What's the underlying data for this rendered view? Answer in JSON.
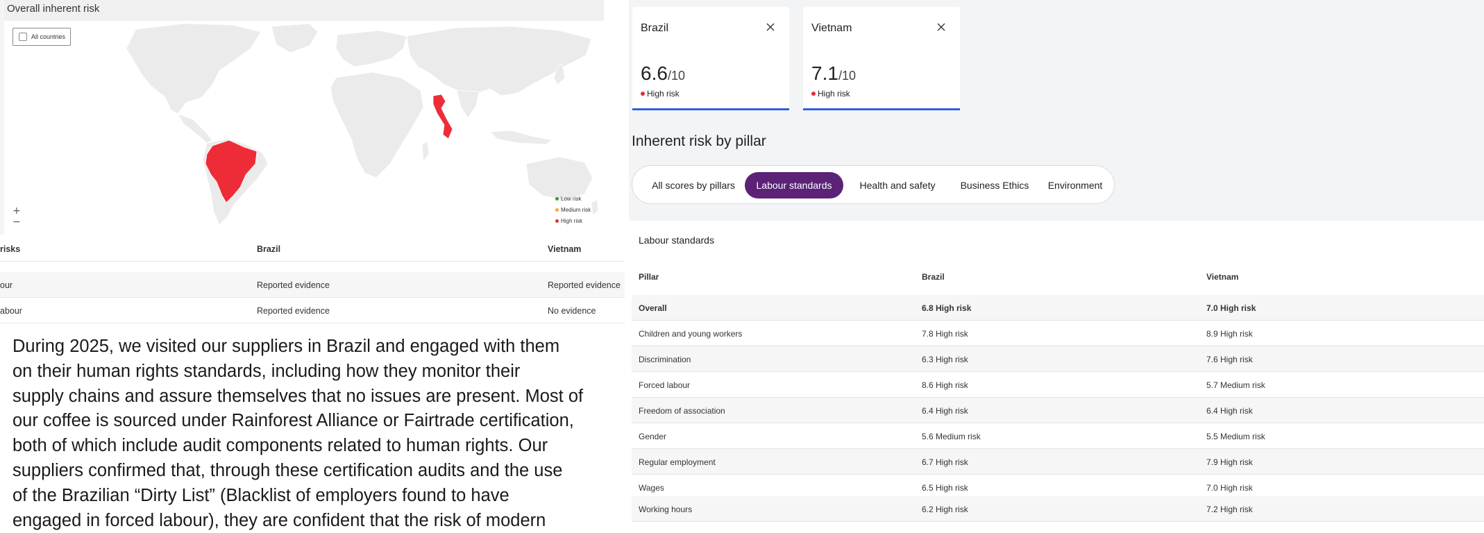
{
  "map": {
    "title": "Overall inherent risk",
    "filter_label": "All countries",
    "zoom_in": "+",
    "zoom_out": "−",
    "legend": [
      {
        "label": "Low risk",
        "color": "#2e9a3e"
      },
      {
        "label": "Medium risk",
        "color": "#f2a73b"
      },
      {
        "label": "High risk",
        "color": "#e0303a"
      }
    ],
    "highlight_color": "#ee2c37",
    "land_color": "#ebebeb"
  },
  "left_table": {
    "headers": [
      "risks",
      "Brazil",
      "Vietnam"
    ],
    "rows": [
      [
        "our",
        "Reported evidence",
        "Reported evidence"
      ],
      [
        "abour",
        "Reported evidence",
        "No evidence"
      ]
    ]
  },
  "paragraph": {
    "lines": [
      "During 2025, we visited our suppliers in Brazil and engaged with them",
      "on their human rights standards, including how they monitor their",
      "supply chains and assure themselves that no issues are present. Most of",
      "our coffee is sourced under Rainforest Alliance or Fairtrade certification,",
      "both of which include audit components related to human rights. Our",
      "suppliers confirmed that, through these certification audits and the use",
      "of the Brazilian “Dirty List” (Blacklist of employers found to have",
      "engaged in forced labour), they are confident that the risk of modern"
    ]
  },
  "cards": [
    {
      "country": "Brazil",
      "score": "6.6",
      "denominator": "/10",
      "risk": "High risk"
    },
    {
      "country": "Vietnam",
      "score": "7.1",
      "denominator": "/10",
      "risk": "High risk"
    }
  ],
  "pillar": {
    "heading": "Inherent risk by pillar",
    "tabs": [
      "All scores by pillars",
      "Labour standards",
      "Health and safety",
      "Business Ethics",
      "Environment"
    ],
    "active_tab": "Labour standards"
  },
  "labour": {
    "title": "Labour standards",
    "headers": [
      "Pillar",
      "Brazil",
      "Vietnam"
    ],
    "rows": [
      [
        "Overall",
        "6.8 High risk",
        "7.0 High risk"
      ],
      [
        "Children and young workers",
        "7.8 High risk",
        "8.9 High risk"
      ],
      [
        "Discrimination",
        "6.3 High risk",
        "7.6 High risk"
      ],
      [
        "Forced labour",
        "8.6 High risk",
        "5.7 Medium risk"
      ],
      [
        "Freedom of association",
        "6.4 High risk",
        "6.4 High risk"
      ],
      [
        "Gender",
        "5.6 Medium risk",
        "5.5 Medium risk"
      ],
      [
        "Regular employment",
        "6.7 High risk",
        "7.9 High risk"
      ],
      [
        "Wages",
        "6.5 High risk",
        "7.0 High risk"
      ],
      [
        "Working hours",
        "6.2 High risk",
        "7.2 High risk"
      ]
    ]
  }
}
